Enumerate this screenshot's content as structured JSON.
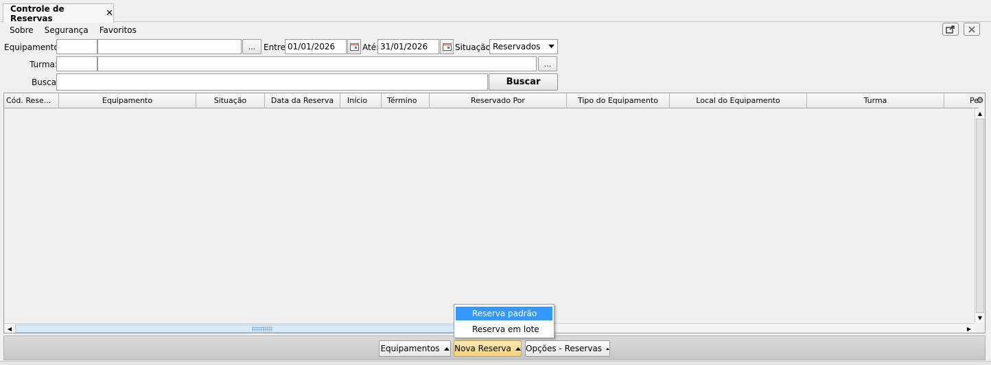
{
  "tab": {
    "title": "Controle de Reservas",
    "close": "✕"
  },
  "menu": [
    {
      "label": "Sobre"
    },
    {
      "label": "Segurança"
    },
    {
      "label": "Favoritos"
    }
  ],
  "filters": {
    "equipamento_label": "Equipamento:",
    "equipamento_code": "",
    "equipamento_name": "",
    "lookup_label": "...",
    "entre_label": "Entre:",
    "entre_value": "01/01/2026",
    "ate_label": "Até:",
    "ate_value": "31/01/2026",
    "situacao_label": "Situação:",
    "situacao_value": "Reservados",
    "turma_label": "Turma:",
    "turma_code": "",
    "turma_name": "",
    "busca_label": "Busca:",
    "busca_value": "",
    "buscar_button": "Buscar"
  },
  "grid": {
    "columns": [
      "Cód. Rese...",
      "Equipamento",
      "Situação",
      "Data da Reserva",
      "Início",
      "Término",
      "Reservado Por",
      "Tipo do Equipamento",
      "Local do Equipamento",
      "Turma",
      "Pe"
    ],
    "rows": []
  },
  "bottom": {
    "equipamentos": "Equipamentos",
    "nova_reserva": "Nova Reserva",
    "opcoes": "Opções - Reservas"
  },
  "popup": {
    "items": [
      "Reserva padrão",
      "Reserva em lote"
    ]
  },
  "icons": {
    "window_popout": "popout-icon",
    "window_close": "close-icon",
    "calendar": "calendar-icon",
    "settings": "gear-icon"
  }
}
